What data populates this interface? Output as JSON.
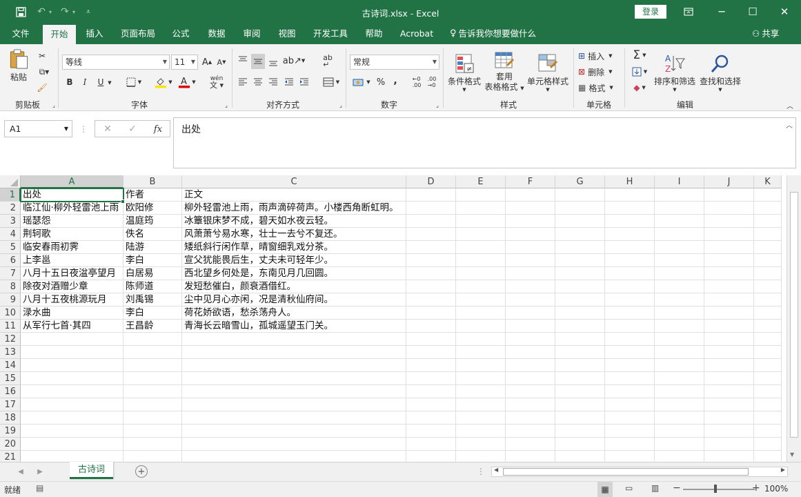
{
  "titlebar": {
    "title": "古诗词.xlsx  -  Excel",
    "login": "登录"
  },
  "tabs": [
    "文件",
    "开始",
    "插入",
    "页面布局",
    "公式",
    "数据",
    "审阅",
    "视图",
    "开发工具",
    "帮助",
    "Acrobat"
  ],
  "tell_me": "告诉我你想要做什么",
  "share": "共享",
  "ribbon": {
    "clipboard": {
      "label": "剪贴板",
      "paste": "粘贴"
    },
    "font": {
      "label": "字体",
      "name": "等线",
      "size": "11",
      "bold": "B",
      "italic": "I",
      "underline": "U",
      "phonetic": "wén"
    },
    "alignment": {
      "label": "对齐方式"
    },
    "number": {
      "label": "数字",
      "format": "常规",
      "percent": "%",
      "comma": ","
    },
    "styles": {
      "label": "样式",
      "conditional": "条件格式",
      "table1": "套用",
      "table2": "表格格式",
      "cell": "单元格样式"
    },
    "cells": {
      "label": "单元格",
      "insert": "插入",
      "delete": "删除",
      "format": "格式"
    },
    "editing": {
      "label": "编辑",
      "sort": "排序和筛选",
      "find": "查找和选择"
    }
  },
  "formula_bar": {
    "cell_ref": "A1",
    "fx": "fx",
    "content": "出处"
  },
  "columns": [
    "A",
    "B",
    "C",
    "D",
    "E",
    "F",
    "G",
    "H",
    "I",
    "J",
    "K"
  ],
  "rows": [
    [
      "出处",
      "作者",
      "正文"
    ],
    [
      "临江仙·柳外轻雷池上雨",
      "欧阳修",
      "柳外轻雷池上雨，雨声滴碎荷声。小楼西角断虹明。"
    ],
    [
      "瑶瑟怨",
      "温庭筠",
      "冰簟银床梦不成，碧天如水夜云轻。"
    ],
    [
      "荆轲歌",
      "佚名",
      "风萧萧兮易水寒，壮士一去兮不复还。"
    ],
    [
      "临安春雨初霁",
      "陆游",
      "矮纸斜行闲作草，晴窗细乳戏分茶。"
    ],
    [
      "上李邕",
      "李白",
      "宣父犹能畏后生，丈夫未可轻年少。"
    ],
    [
      "八月十五日夜湓亭望月",
      "白居易",
      "西北望乡何处是，东南见月几回圆。"
    ],
    [
      "除夜对酒赠少章",
      "陈师道",
      "发短愁催白，颜衰酒借红。"
    ],
    [
      "八月十五夜桃源玩月",
      "刘禹锡",
      "尘中见月心亦闲，况是清秋仙府间。"
    ],
    [
      "渌水曲",
      "李白",
      "荷花娇欲语，愁杀荡舟人。"
    ],
    [
      "从军行七首·其四",
      "王昌龄",
      "青海长云暗雪山，孤城遥望玉门关。"
    ]
  ],
  "row_numbers": [
    "1",
    "2",
    "3",
    "4",
    "5",
    "6",
    "7",
    "8",
    "9",
    "10",
    "11",
    "12",
    "13",
    "14",
    "15",
    "16",
    "17",
    "18",
    "19",
    "20",
    "21"
  ],
  "sheet_tab": "古诗词",
  "status": {
    "ready": "就绪",
    "zoom": "100%"
  },
  "colors": {
    "accent": "#217346"
  }
}
